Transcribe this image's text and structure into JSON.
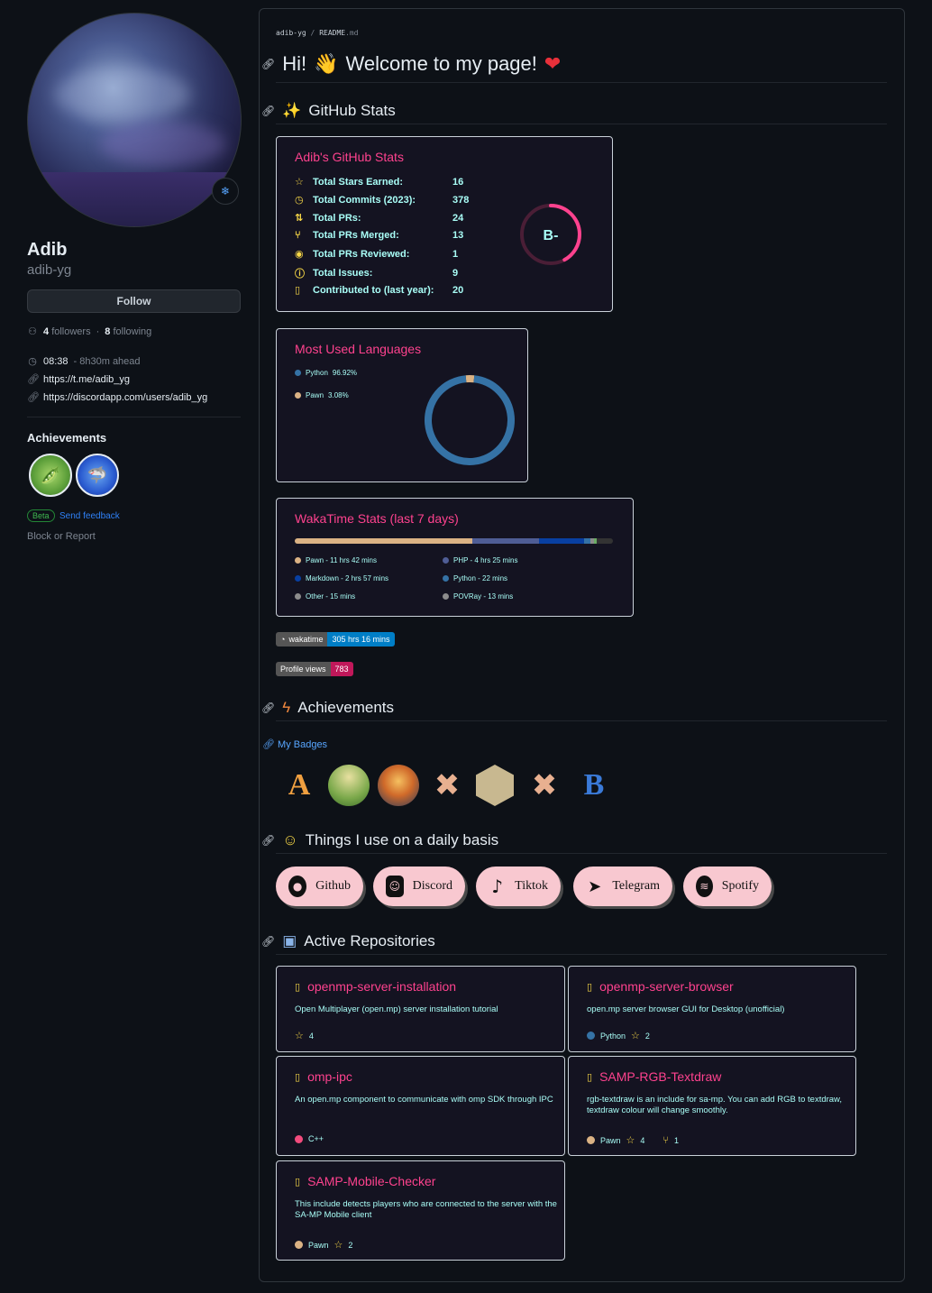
{
  "profile": {
    "name": "Adib",
    "login": "adib-yg",
    "follow_label": "Follow",
    "followers_count": "4",
    "followers_label": "followers",
    "following_count": "8",
    "following_label": "following",
    "separator": "·",
    "local_time": "08:38",
    "time_offset": "- 8h30m ahead",
    "links": [
      "https://t.me/adib_yg",
      "https://discordapp.com/users/adib_yg"
    ],
    "achievements_title": "Achievements",
    "beta_label": "Beta",
    "feedback_label": "Send feedback",
    "block_label": "Block or Report"
  },
  "readme": {
    "breadcrumb_user": "adib-yg",
    "breadcrumb_sep": "/",
    "breadcrumb_file": "README",
    "breadcrumb_ext": ".md",
    "heading_hi": "Hi!",
    "heading_welcome": "Welcome to my page!",
    "heading_stats": "GitHub Stats",
    "heading_achievements": "Achievements",
    "my_badges_label": "My Badges",
    "heading_daily": "Things I use on a daily basis",
    "heading_repos": "Active Repositories"
  },
  "stats_card": {
    "title": "Adib's GitHub Stats",
    "rows": [
      {
        "icon": "star-icon",
        "label": "Total Stars Earned:",
        "value": "16"
      },
      {
        "icon": "clock-icon",
        "label": "Total Commits (2023):",
        "value": "378"
      },
      {
        "icon": "pr-icon",
        "label": "Total PRs:",
        "value": "24"
      },
      {
        "icon": "merge-icon",
        "label": "Total PRs Merged:",
        "value": "13"
      },
      {
        "icon": "eye-icon",
        "label": "Total PRs Reviewed:",
        "value": "1"
      },
      {
        "icon": "issue-icon",
        "label": "Total Issues:",
        "value": "9"
      },
      {
        "icon": "repo-icon",
        "label": "Contributed to (last year):",
        "value": "20"
      }
    ],
    "rank": "B-",
    "rank_progress": 0.42
  },
  "languages_card": {
    "title": "Most Used Languages",
    "items": [
      {
        "name": "Python",
        "percent": "96.92%",
        "value": 96.92,
        "color": "#3572A5"
      },
      {
        "name": "Pawn",
        "percent": "3.08%",
        "value": 3.08,
        "color": "#dbb284"
      }
    ]
  },
  "waka_card": {
    "title": "WakaTime Stats (last 7 days)",
    "items": [
      {
        "name": "Pawn",
        "time": "11 hrs 42 mins",
        "color": "#dbb284",
        "share": 0.558
      },
      {
        "name": "PHP",
        "time": "4 hrs 25 mins",
        "color": "#4F5D95",
        "share": 0.211
      },
      {
        "name": "Markdown",
        "time": "2 hrs 57 mins",
        "color": "#083fa1",
        "share": 0.141
      },
      {
        "name": "Python",
        "time": "22 mins",
        "color": "#3572A5",
        "share": 0.018
      },
      {
        "name": "Other",
        "time": "15 mins",
        "color": "#8c8c8c",
        "share": 0.012
      },
      {
        "name": "POVRay",
        "time": "13 mins",
        "color": "#6bac65",
        "share": 0.01
      }
    ],
    "item_separator": " - "
  },
  "shields": {
    "wakatime_label": "wakatime",
    "wakatime_value": "305 hrs 16 mins",
    "views_label": "Profile views",
    "views_value": "783"
  },
  "socials": [
    "Github",
    "Discord",
    "Tiktok",
    "Telegram",
    "Spotify"
  ],
  "repos": [
    {
      "name": "openmp-server-installation",
      "desc": "Open Multiplayer (open.mp) server installation tutorial",
      "lang": "",
      "lang_color": "",
      "stars": "4",
      "forks": ""
    },
    {
      "name": "openmp-server-browser",
      "desc": "open.mp server browser GUI for Desktop (unofficial)",
      "lang": "Python",
      "lang_color": "#3572A5",
      "stars": "2",
      "forks": ""
    },
    {
      "name": "omp-ipc",
      "desc": "An open.mp component to communicate with omp SDK through IPC",
      "lang": "C++",
      "lang_color": "#f34b7d",
      "stars": "",
      "forks": ""
    },
    {
      "name": "SAMP-RGB-Textdraw",
      "desc": "rgb-textdraw is an include for sa-mp. You can add RGB to textdraw, textdraw colour will change smoothly.",
      "lang": "Pawn",
      "lang_color": "#dbb284",
      "stars": "4",
      "forks": "1"
    },
    {
      "name": "SAMP-Mobile-Checker",
      "desc": "This include detects players who are connected to the server with the SA-MP Mobile client",
      "lang": "Pawn",
      "lang_color": "#dbb284",
      "stars": "2",
      "forks": ""
    }
  ],
  "colors": {
    "accent": "#fe428e",
    "text": "#a9fef7",
    "icon": "#f8d847",
    "card_bg": "#141321"
  }
}
